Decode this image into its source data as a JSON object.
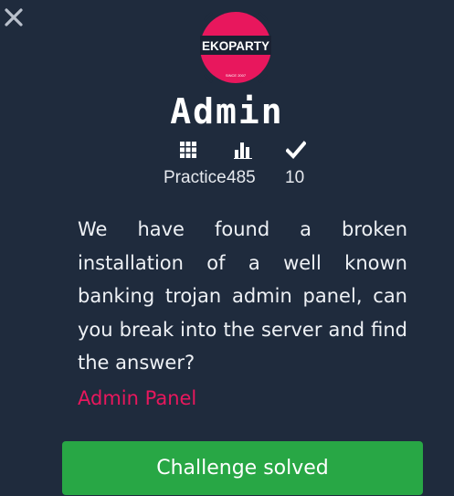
{
  "challenge": {
    "logo_text": "EKOPARTY",
    "logo_subtext": "SINCE 2007",
    "title": "Admin",
    "category": "Practice",
    "points": "485",
    "solves": "10",
    "category_icon": "grid-icon",
    "points_icon": "bar-chart-icon",
    "solves_icon": "check-icon",
    "description": "We have found a broken installation of a well known banking trojan admin panel, can you break into the server and find the answer?",
    "link_label": "Admin Panel",
    "button_label": "Challenge solved"
  },
  "colors": {
    "background": "#1f2b3d",
    "accent": "#e8175d",
    "success": "#28a745",
    "text": "#ffffff"
  }
}
